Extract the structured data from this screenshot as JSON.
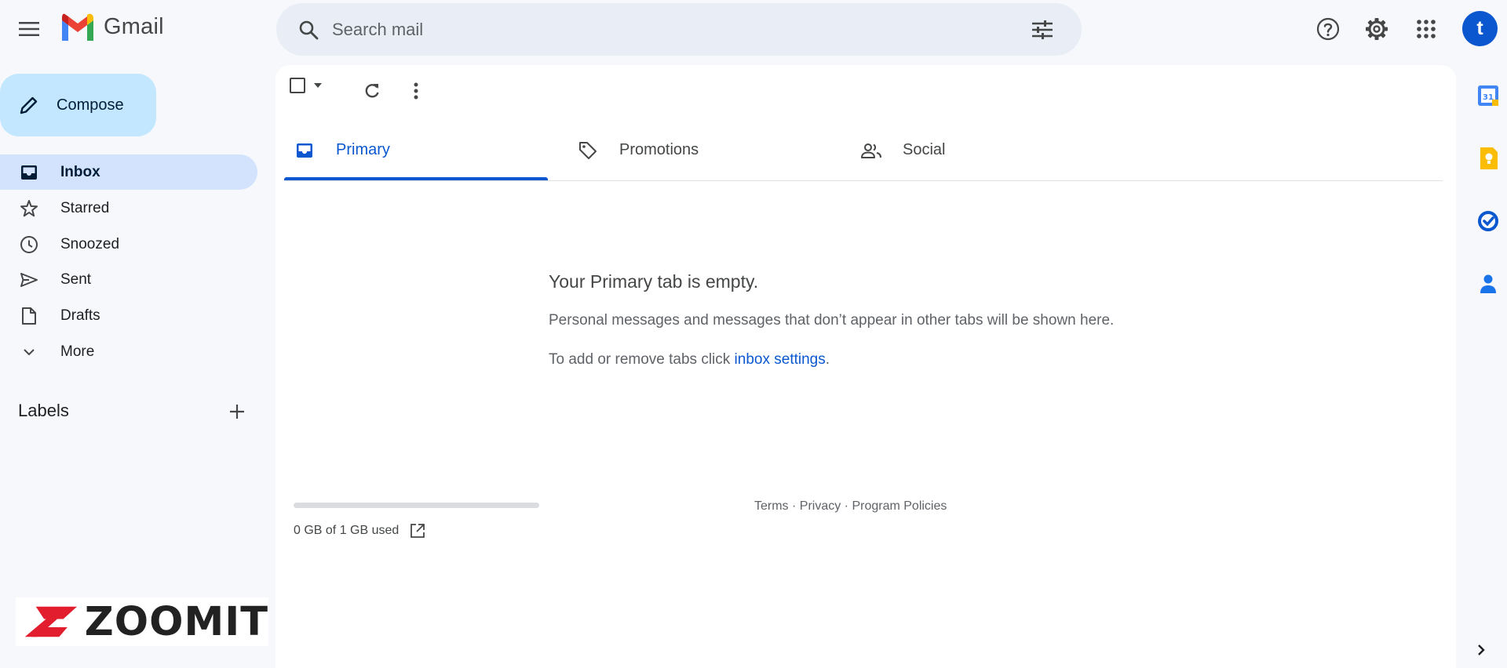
{
  "app": {
    "logo_text": "Gmail",
    "avatar_initial": "t"
  },
  "colors": {
    "accent": "#0b57d0",
    "compose_bg": "#c2e7ff",
    "active_nav_bg": "#d3e3fd",
    "page_bg": "#f6f8fc"
  },
  "search": {
    "placeholder": "Search mail"
  },
  "compose": {
    "label": "Compose"
  },
  "sidebar": {
    "items": [
      {
        "label": "Inbox",
        "icon": "inbox-icon",
        "active": true
      },
      {
        "label": "Starred",
        "icon": "star-icon"
      },
      {
        "label": "Snoozed",
        "icon": "clock-icon"
      },
      {
        "label": "Sent",
        "icon": "send-icon"
      },
      {
        "label": "Drafts",
        "icon": "draft-icon"
      },
      {
        "label": "More",
        "icon": "chevron-down-icon"
      }
    ],
    "labels_title": "Labels"
  },
  "tabs": [
    {
      "label": "Primary",
      "icon": "inbox-icon",
      "active": true
    },
    {
      "label": "Promotions",
      "icon": "tag-icon"
    },
    {
      "label": "Social",
      "icon": "people-icon"
    }
  ],
  "empty_state": {
    "title": "Your Primary tab is empty.",
    "description": "Personal messages and messages that don’t appear in other tabs will be shown here.",
    "settings_prefix": "To add or remove tabs click ",
    "settings_link": "inbox settings",
    "settings_suffix": "."
  },
  "storage": {
    "text": "0 GB of 1 GB used",
    "used_fraction": 0
  },
  "footer": {
    "terms": "Terms",
    "privacy": "Privacy",
    "policies": "Program Policies",
    "separator": " · "
  },
  "side_panel": {
    "apps": [
      "calendar-icon",
      "keep-icon",
      "tasks-icon",
      "contacts-icon"
    ],
    "calendar_day": "31"
  },
  "watermark": {
    "text": "ZOOMIT"
  }
}
